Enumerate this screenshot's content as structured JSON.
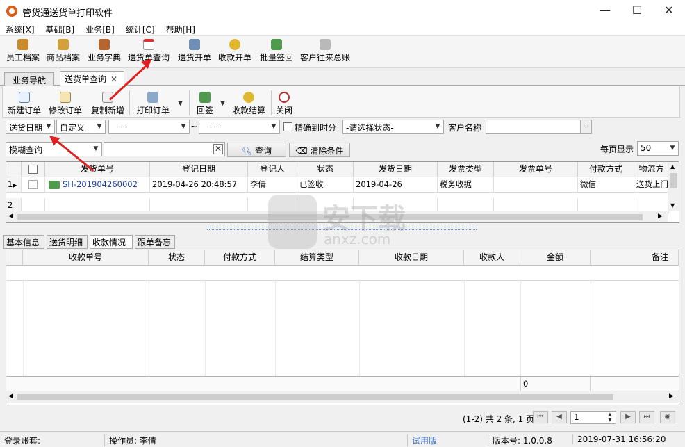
{
  "window": {
    "title": "管货通送货单打印软件"
  },
  "menu": [
    "系统[X]",
    "基础[B]",
    "业务[B]",
    "统计[C]",
    "帮助[H]"
  ],
  "toolbar": [
    {
      "label": "员工档案",
      "icon": "employee-icon",
      "color": "#c98a2b"
    },
    {
      "label": "商品档案",
      "icon": "goods-icon",
      "color": "#d4a03b"
    },
    {
      "label": "业务字典",
      "icon": "book-icon",
      "color": "#b5652e"
    },
    {
      "label": "送货单查询",
      "icon": "calendar-icon",
      "color": "#c7c7c7"
    },
    {
      "label": "送货开单",
      "icon": "document-icon",
      "color": "#6f8fb4"
    },
    {
      "label": "收款开单",
      "icon": "coins-icon",
      "color": "#e0b830"
    },
    {
      "label": "批量签回",
      "icon": "truck-icon",
      "color": "#4f9a4c"
    },
    {
      "label": "客户往来总账",
      "icon": "ledger-icon",
      "color": "#b9b9b9"
    }
  ],
  "tabs": {
    "nav": "业务导航",
    "active": "送货单查询",
    "close": "✕"
  },
  "subtoolbar": [
    "新建订单",
    "修改订单",
    "复制新增",
    "打印订单",
    "回签",
    "收款结算",
    "关闭"
  ],
  "filters": {
    "date_field": "送货日期",
    "date_mode": "自定义",
    "date_from": "- -",
    "tilde": "~",
    "date_to": "- -",
    "precise_label": "精确到时分",
    "status_select": "-请选择状态-",
    "customer_label": "客户名称",
    "customer_value": "",
    "fuzzy_select": "模糊查询",
    "search_value": "",
    "search_btn": "查询",
    "clear_btn": "清除条件",
    "page_size_label": "每页显示",
    "page_size": "50"
  },
  "orders": {
    "headers": [
      "发货单号",
      "登记日期",
      "登记人",
      "状态",
      "发货日期",
      "发票类型",
      "发票单号",
      "付款方式",
      "物流方"
    ],
    "rows": [
      {
        "num": "1",
        "order": "SH-201904260002",
        "reg_date": "2019-04-26  20:48:57",
        "registrar": "李倩",
        "status": "已签收",
        "ship_date": "2019-04-26",
        "invoice_type": "税务收据",
        "invoice_no": "",
        "payment": "微信",
        "logistics": "送货上门"
      },
      {
        "num": "2",
        "order": "",
        "reg_date": "",
        "registrar": "",
        "status": "",
        "ship_date": "",
        "invoice_type": "",
        "invoice_no": "",
        "payment": "",
        "logistics": ""
      }
    ]
  },
  "detail_tabs": [
    "基本信息",
    "送货明细",
    "收款情况",
    "跟单备忘"
  ],
  "receipts": {
    "headers": [
      "收款单号",
      "状态",
      "付款方式",
      "结算类型",
      "收款日期",
      "收款人",
      "金额",
      "备注"
    ],
    "total_amount": "0"
  },
  "pager": {
    "info": "(1-2) 共 2 条, 1 页",
    "page": "1"
  },
  "status": {
    "account_label": "登录账套:",
    "operator": "操作员: 李倩",
    "trial": "试用版",
    "version": "版本号: 1.0.0.8",
    "datetime": "2019-07-31  16:56:20"
  },
  "watermark": {
    "cn": "安下载",
    "en": "anxz.com"
  }
}
